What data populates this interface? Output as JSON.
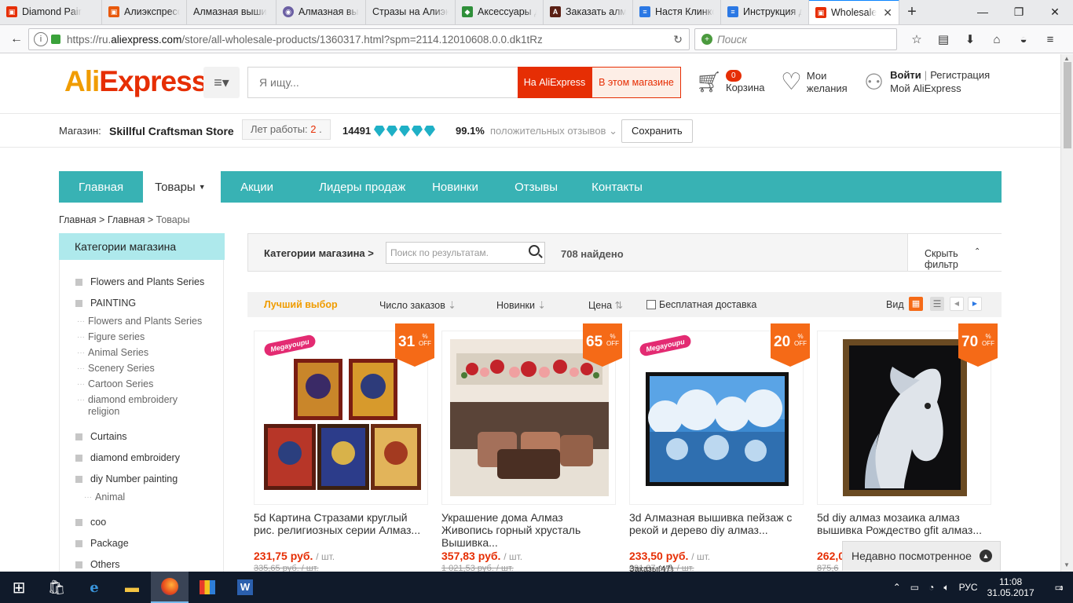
{
  "browser": {
    "tabs": [
      {
        "title": "Diamond Pair",
        "icon_color": "#e62e04"
      },
      {
        "title": "Алиэкспресс",
        "icon_color": "#e8590c"
      },
      {
        "title": "Алмазная выши",
        "icon_color": ""
      },
      {
        "title": "Алмазная вы",
        "icon_color": "#6b5fa3"
      },
      {
        "title": "Стразы на Алиэк",
        "icon_color": ""
      },
      {
        "title": "Аксессуары д",
        "icon_color": "#2f8f3a"
      },
      {
        "title": "Заказать алм",
        "icon_color": "#5a1f14"
      },
      {
        "title": "Настя Клинко",
        "icon_color": "#2b78e4"
      },
      {
        "title": "Инструкция д",
        "icon_color": "#2b78e4"
      },
      {
        "title": "Wholesale",
        "icon_color": "#e62e04",
        "active": true
      }
    ],
    "url_prefix": "https://ru.",
    "url_domain": "aliexpress.com",
    "url_rest": "/store/all-wholesale-products/1360317.html?spm=2114.12010608.0.0.dk1tRz",
    "search_placeholder": "Поиск"
  },
  "header": {
    "logo_a": "Ali",
    "logo_b": "Express",
    "search_placeholder": "Я ищу...",
    "search_btn_all": "На AliExpress",
    "search_btn_store": "В этом магазине",
    "cart_count": "0",
    "cart_label": "Корзина",
    "wish_line1": "Мои",
    "wish_line2": "желания",
    "login": "Войти",
    "register": "Регистрация",
    "my_ali": "Мой AliExpress"
  },
  "store": {
    "label": "Магазин:",
    "name": "Skillful Craftsman Store",
    "years_label": "Лет работы:",
    "years": "2",
    "score": "14491",
    "positive": "99.1%",
    "feedback_label": "положительных отзывов",
    "save": "Сохранить"
  },
  "nav": [
    "Главная",
    "Товары",
    "Акции",
    "Лидеры продаж",
    "Новинки",
    "Отзывы",
    "Контакты"
  ],
  "breadcrumb": {
    "a": "Главная",
    "b": "Главная",
    "c": "Товары"
  },
  "sidebar": {
    "title": "Категории магазина",
    "items": [
      "Flowers and Plants Series",
      "PAINTING",
      "Curtains",
      "diamond embroidery",
      "diy Number painting",
      "coo",
      "Package",
      "Others"
    ],
    "painting_subs": [
      "Flowers and Plants Series",
      "Figure series",
      "Animal Series",
      "Scenery Series",
      "Cartoon Series",
      "diamond embroidery religion"
    ],
    "number_subs": [
      "Animal"
    ]
  },
  "filter": {
    "label": "Категории магазина >",
    "search_placeholder": "Поиск по результатам.",
    "found": "708 найдено",
    "hide": "Скрыть фильтр"
  },
  "sort": {
    "best": "Лучший выбор",
    "orders": "Число заказов",
    "newest": "Новинки",
    "price": "Цена",
    "free_shipping": "Бесплатная доставка",
    "view": "Вид"
  },
  "products": [
    {
      "discount": "31",
      "title": "5d Картина Стразами круглый рис. религиозных серии Алмаз...",
      "price": "231,75 руб.",
      "unit": "/ шт.",
      "old": "335,65 руб. / шт.",
      "mega": "Megayoupu"
    },
    {
      "discount": "65",
      "title": "Украшение дома Алмаз Живопись горный хрусталь Вышивка...",
      "price": "357,83 руб.",
      "unit": "/ шт.",
      "old": "1 021,53 руб. / шт."
    },
    {
      "discount": "20",
      "title": "3d Алмазная вышивка пейзаж с рекой и дерево diy алмаз...",
      "price": "233,50 руб.",
      "unit": "/ шт.",
      "old": "291,87 руб. / шт.",
      "mega": "Megayoupu",
      "orders": "Заказы(47)"
    },
    {
      "discount": "70",
      "title": "5d diy алмаз мозаика алмаз вышивка Рождество gfit алмаз...",
      "price": "262,0",
      "unit": "",
      "old": "875,6"
    }
  ],
  "off_label": "OFF",
  "recent": "Недавно посмотренное",
  "taskbar": {
    "lang": "РУС",
    "time": "11:08",
    "date": "31.05.2017",
    "notif": "4"
  }
}
